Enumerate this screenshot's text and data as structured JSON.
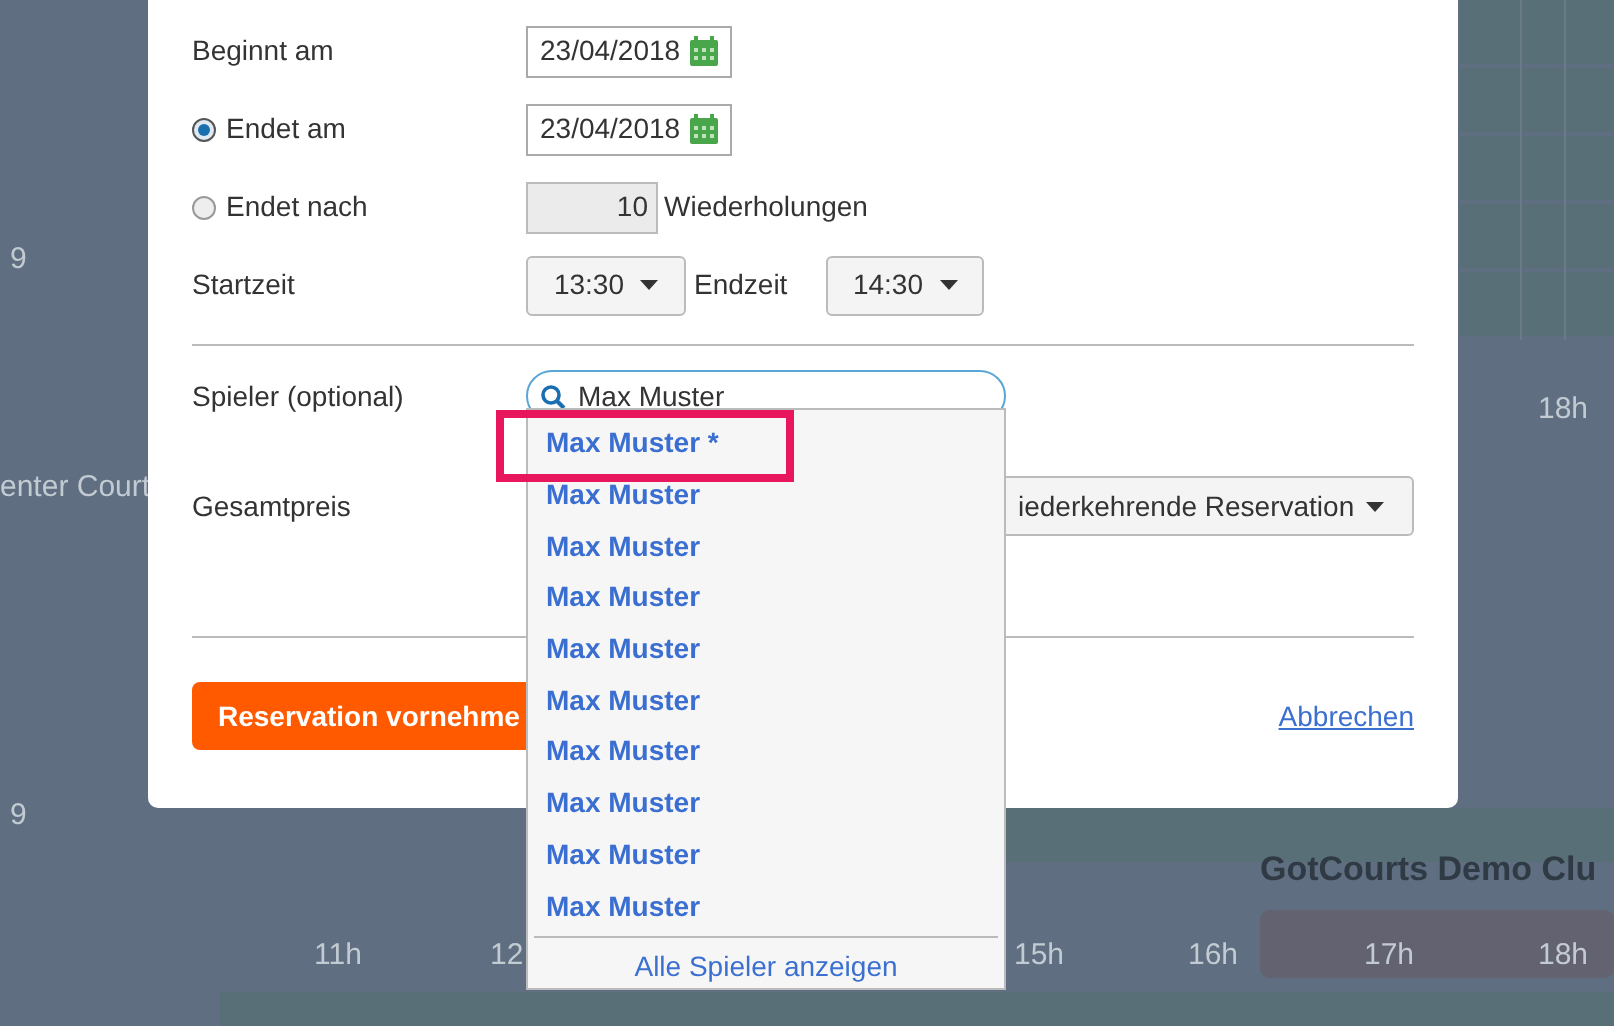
{
  "background": {
    "texts": [
      "9",
      "enter Court",
      "18h",
      "9",
      "11h",
      "12",
      "15h",
      "16h",
      "17h",
      "18h"
    ],
    "club_title": "GotCourts Demo Clu"
  },
  "form": {
    "start": {
      "label": "Beginnt am",
      "value": "23/04/2018"
    },
    "end_options": [
      {
        "label": "Endet am",
        "selected": true,
        "kind": "date",
        "value": "23/04/2018"
      },
      {
        "label": "Endet nach",
        "selected": false,
        "kind": "count",
        "value": "10",
        "suffix": "Wiederholungen"
      }
    ],
    "start_time": {
      "label": "Startzeit",
      "value": "13:30"
    },
    "end_time": {
      "label": "Endzeit",
      "value": "14:30"
    },
    "player": {
      "label": "Spieler (optional)",
      "value": "Max Muster"
    },
    "price": {
      "label": "Gesamtpreis",
      "select_value": "iederkehrende Reservation"
    },
    "submit": "Reservation vornehme",
    "cancel": "Abbrechen"
  },
  "suggestions": {
    "items": [
      {
        "label": "Max Muster *",
        "highlighted": true
      },
      {
        "label": "Max Muster",
        "highlighted": false
      },
      {
        "label": "Max Muster",
        "highlighted": false
      },
      {
        "label": "Max Muster",
        "highlighted": false
      },
      {
        "label": "Max Muster",
        "highlighted": false
      },
      {
        "label": "Max Muster",
        "highlighted": false
      },
      {
        "label": "Max Muster",
        "highlighted": false
      },
      {
        "label": "Max Muster",
        "highlighted": false
      },
      {
        "label": "Max Muster",
        "highlighted": false
      },
      {
        "label": "Max Muster",
        "highlighted": false
      }
    ],
    "footer": "Alle Spieler anzeigen"
  }
}
